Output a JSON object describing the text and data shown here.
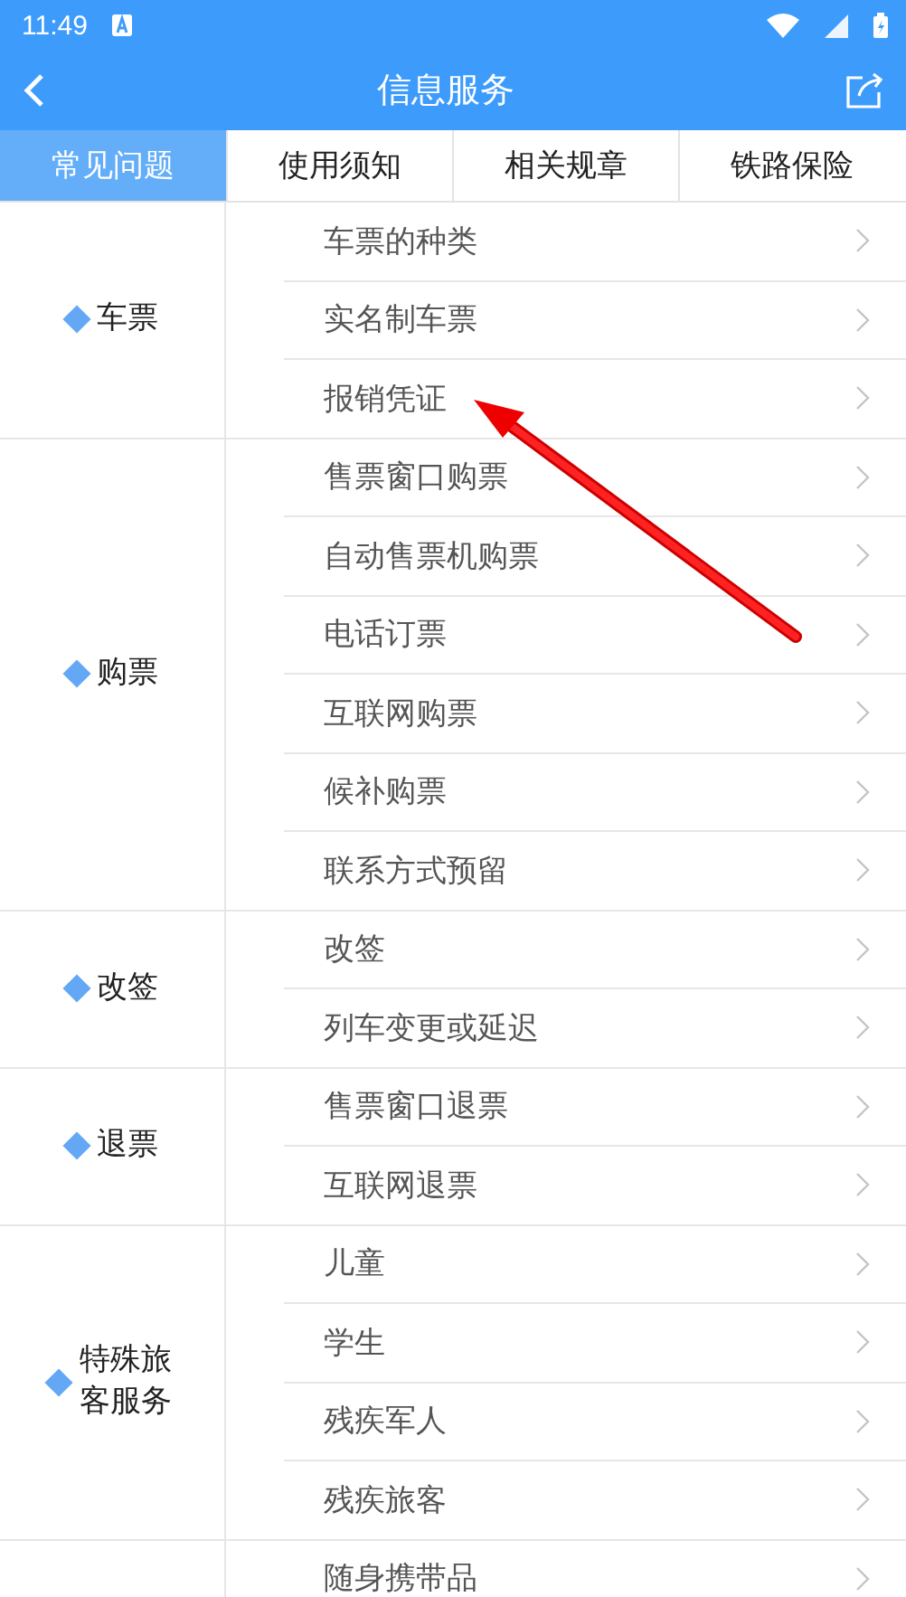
{
  "status_bar": {
    "time": "11:49"
  },
  "header": {
    "title": "信息服务"
  },
  "tabs": [
    {
      "label": "常见问题",
      "selected": true
    },
    {
      "label": "使用须知",
      "selected": false
    },
    {
      "label": "相关规章",
      "selected": false
    },
    {
      "label": "铁路保险",
      "selected": false
    }
  ],
  "groups": [
    {
      "label": "车票",
      "items": [
        "车票的种类",
        "实名制车票",
        "报销凭证"
      ]
    },
    {
      "label": "购票",
      "items": [
        "售票窗口购票",
        "自动售票机购票",
        "电话订票",
        "互联网购票",
        "候补购票",
        "联系方式预留"
      ]
    },
    {
      "label": "改签",
      "items": [
        "改签",
        "列车变更或延迟"
      ]
    },
    {
      "label": "退票",
      "items": [
        "售票窗口退票",
        "互联网退票"
      ]
    },
    {
      "label": "特殊旅客服务",
      "items": [
        "儿童",
        "学生",
        "残疾军人",
        "残疾旅客"
      ]
    },
    {
      "items": [
        "随身携带品"
      ]
    }
  ]
}
